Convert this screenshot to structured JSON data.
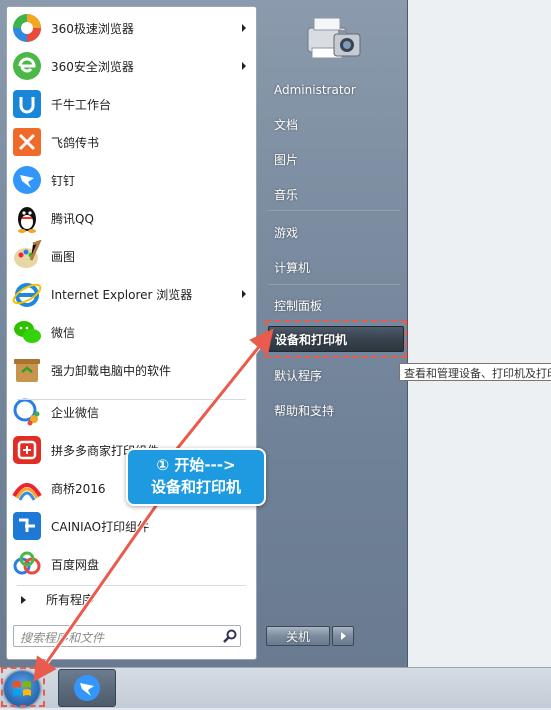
{
  "programs": [
    {
      "label": "360极速浏览器",
      "icon": "browser-360-speed-icon",
      "submenu": true
    },
    {
      "label": "360安全浏览器",
      "icon": "browser-360-safe-icon",
      "submenu": true
    },
    {
      "label": "千牛工作台",
      "icon": "qianniu-icon",
      "submenu": false
    },
    {
      "label": "飞鸽传书",
      "icon": "feige-icon",
      "submenu": false
    },
    {
      "label": "钉钉",
      "icon": "dingtalk-icon",
      "submenu": false
    },
    {
      "label": "腾讯QQ",
      "icon": "qq-penguin-icon",
      "submenu": false
    },
    {
      "label": "画图",
      "icon": "paint-icon",
      "submenu": false
    },
    {
      "label": "Internet Explorer 浏览器",
      "icon": "internet-explorer-icon",
      "submenu": true
    },
    {
      "label": "微信",
      "icon": "wechat-icon",
      "submenu": false
    },
    {
      "label": "强力卸载电脑中的软件",
      "icon": "uninstall-icon",
      "submenu": false
    },
    {
      "label": "企业微信",
      "icon": "wecom-icon",
      "submenu": false
    },
    {
      "label": "拼多多商家打印组件",
      "icon": "pdd-print-icon",
      "submenu": false
    },
    {
      "label": "商桥2016",
      "icon": "shangqiao-icon",
      "submenu": false
    },
    {
      "label": "CAINIAO打印组件",
      "icon": "cainiao-print-icon",
      "submenu": false
    },
    {
      "label": "百度网盘",
      "icon": "baidu-netdisk-icon",
      "submenu": false
    }
  ],
  "all_programs": "所有程序",
  "search_placeholder": "搜索程序和文件",
  "right_items": [
    {
      "label": "Administrator"
    },
    {
      "label": "文档"
    },
    {
      "label": "图片"
    },
    {
      "label": "音乐"
    },
    {
      "label": "游戏"
    },
    {
      "label": "计算机"
    },
    {
      "label": "控制面板"
    },
    {
      "label": "设备和打印机"
    },
    {
      "label": "默认程序"
    },
    {
      "label": "帮助和支持"
    }
  ],
  "shutdown_label": "关机",
  "tooltip": "查看和管理设备、打印机及打印作业",
  "callout": {
    "line1": "① 开始--->",
    "line2": "设备和打印机"
  },
  "colors": {
    "accent_red": "#e85b4d",
    "callout_blue": "#1e9be0"
  }
}
